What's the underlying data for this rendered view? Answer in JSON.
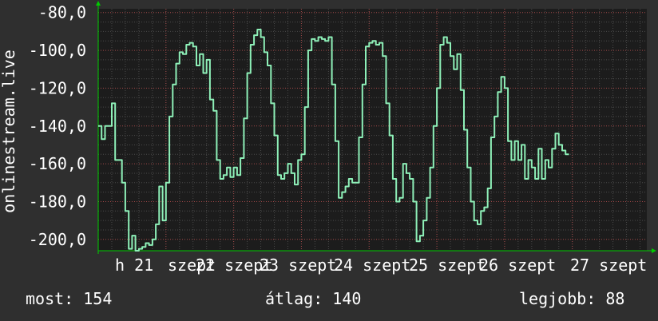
{
  "chart_data": {
    "type": "line",
    "ylabel": "onlinestream.live",
    "ylim": [
      -206,
      -78
    ],
    "yticks": [
      "-80,0",
      "-100,0",
      "-120,0",
      "-140,0",
      "-160,0",
      "-180,0",
      "-200,0"
    ],
    "ytick_values": [
      -80,
      -100,
      -120,
      -140,
      -160,
      -180,
      -200
    ],
    "xlim": [
      0,
      162
    ],
    "xticks": [
      "h 21",
      "szept",
      "22 szept",
      "23 szept",
      "24 szept",
      "25 szept",
      "26 szept",
      "27 szept"
    ],
    "xtick_values": [
      0,
      20,
      40,
      60,
      80,
      100,
      120,
      140
    ],
    "grid": true,
    "colors": {
      "background": "#2f2f2f",
      "plot": "#1c1c1c",
      "line": "#8ef0b8",
      "axis": "#00cc00",
      "grid_major": "#a04848",
      "grid_minor": "#4a4a4a"
    },
    "series": [
      {
        "values": [
          -140,
          -147,
          -140,
          -140,
          -128,
          -158,
          -158,
          -170,
          -185,
          -205,
          -198,
          -206,
          -205,
          -204,
          -202,
          -203,
          -200,
          -192,
          -172,
          -190,
          -170,
          -135,
          -118,
          -107,
          -101,
          -102,
          -97,
          -96,
          -98,
          -108,
          -102,
          -112,
          -105,
          -126,
          -132,
          -158,
          -168,
          -166,
          -162,
          -167,
          -162,
          -166,
          -157,
          -136,
          -112,
          -97,
          -92,
          -89,
          -93,
          -101,
          -108,
          -128,
          -145,
          -166,
          -168,
          -165,
          -160,
          -165,
          -171,
          -158,
          -155,
          -130,
          -100,
          -94,
          -95,
          -93,
          -94,
          -95,
          -93,
          -118,
          -148,
          -178,
          -175,
          -172,
          -168,
          -170,
          -170,
          -146,
          -118,
          -98,
          -96,
          -95,
          -97,
          -96,
          -103,
          -128,
          -145,
          -168,
          -180,
          -178,
          -160,
          -165,
          -168,
          -180,
          -201,
          -198,
          -190,
          -178,
          -162,
          -140,
          -120,
          -97,
          -93,
          -96,
          -103,
          -110,
          -102,
          -121,
          -142,
          -162,
          -180,
          -190,
          -192,
          -185,
          -183,
          -173,
          -146,
          -135,
          -122,
          -114,
          -120,
          -148,
          -158,
          -148,
          -158,
          -150,
          -168,
          -158,
          -162,
          -168,
          -152,
          -168,
          -158,
          -162,
          -152,
          -144,
          -150,
          -153,
          -155
        ]
      }
    ]
  },
  "stats": {
    "now": "most: 154",
    "avg": "átlag: 140",
    "best": "legjobb: 88"
  }
}
